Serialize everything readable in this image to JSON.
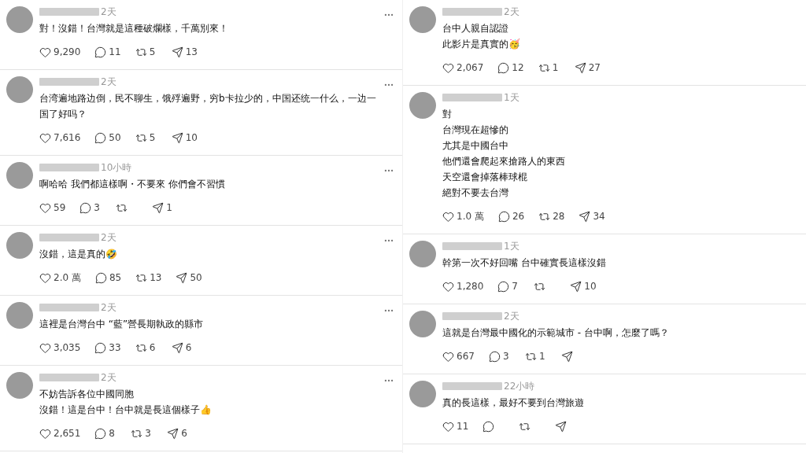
{
  "columns": [
    {
      "comments": [
        {
          "time": "2天",
          "lines": [
            "對！沒錯！台灣就是這種破爛樣，千萬別來！"
          ],
          "likes": "9,290",
          "replies": "11",
          "reposts": "5",
          "shares": "13",
          "more_menu": true
        },
        {
          "time": "2天",
          "lines": [
            "台湾遍地路边倒，民不聊生，饿殍遍野，穷b卡拉少的，中国还统一什么，一边一",
            "国了好吗？"
          ],
          "likes": "7,616",
          "replies": "50",
          "reposts": "5",
          "shares": "10",
          "more_menu": true
        },
        {
          "time": "10小時",
          "lines": [
            "啊哈哈 我們都這樣啊・不要來 你們會不習慣"
          ],
          "likes": "59",
          "replies": "3",
          "shares": "1",
          "more_menu": true
        },
        {
          "time": "2天",
          "lines": [
            "沒錯，這是真的🤣"
          ],
          "likes": "2.0 萬",
          "replies": "85",
          "reposts": "13",
          "shares": "50",
          "more_menu": true
        },
        {
          "time": "2天",
          "lines": [
            "這裡是台灣台中 “藍”營長期執政的縣市"
          ],
          "likes": "3,035",
          "replies": "33",
          "reposts": "6",
          "shares": "6",
          "more_menu": true
        },
        {
          "time": "2天",
          "lines": [
            "不妨告訴各位中國同胞",
            "沒錯！這是台中！台中就是長這個樣子👍"
          ],
          "likes": "2,651",
          "replies": "8",
          "reposts": "3",
          "shares": "6",
          "more_menu": true
        }
      ]
    },
    {
      "comments": [
        {
          "time": "2天",
          "lines": [
            "台中人親自認證",
            "此影片是真實的🥳"
          ],
          "likes": "2,067",
          "replies": "12",
          "reposts": "1",
          "shares": "27",
          "more_menu": false
        },
        {
          "time": "1天",
          "lines": [
            "對",
            "台灣現在超慘的",
            "尤其是中國台中",
            "他們還會爬起來搶路人的東西",
            "天空還會掉落棒球棍",
            "絕對不要去台灣"
          ],
          "likes": "1.0 萬",
          "replies": "26",
          "reposts": "28",
          "shares": "34",
          "more_menu": false
        },
        {
          "time": "1天",
          "lines": [
            "幹第一次不好回嘴 台中確實長這樣沒錯"
          ],
          "likes": "1,280",
          "replies": "7",
          "shares": "10",
          "more_menu": false
        },
        {
          "time": "2天",
          "lines": [
            "這就是台灣最中國化的示範城市 - 台中啊，怎麼了嗎？"
          ],
          "likes": "667",
          "replies": "3",
          "reposts": "1",
          "more_menu": false
        },
        {
          "time": "22小時",
          "lines": [
            "真的長這樣，最好不要到台灣旅遊"
          ],
          "likes": "11",
          "more_menu": false
        }
      ]
    }
  ]
}
